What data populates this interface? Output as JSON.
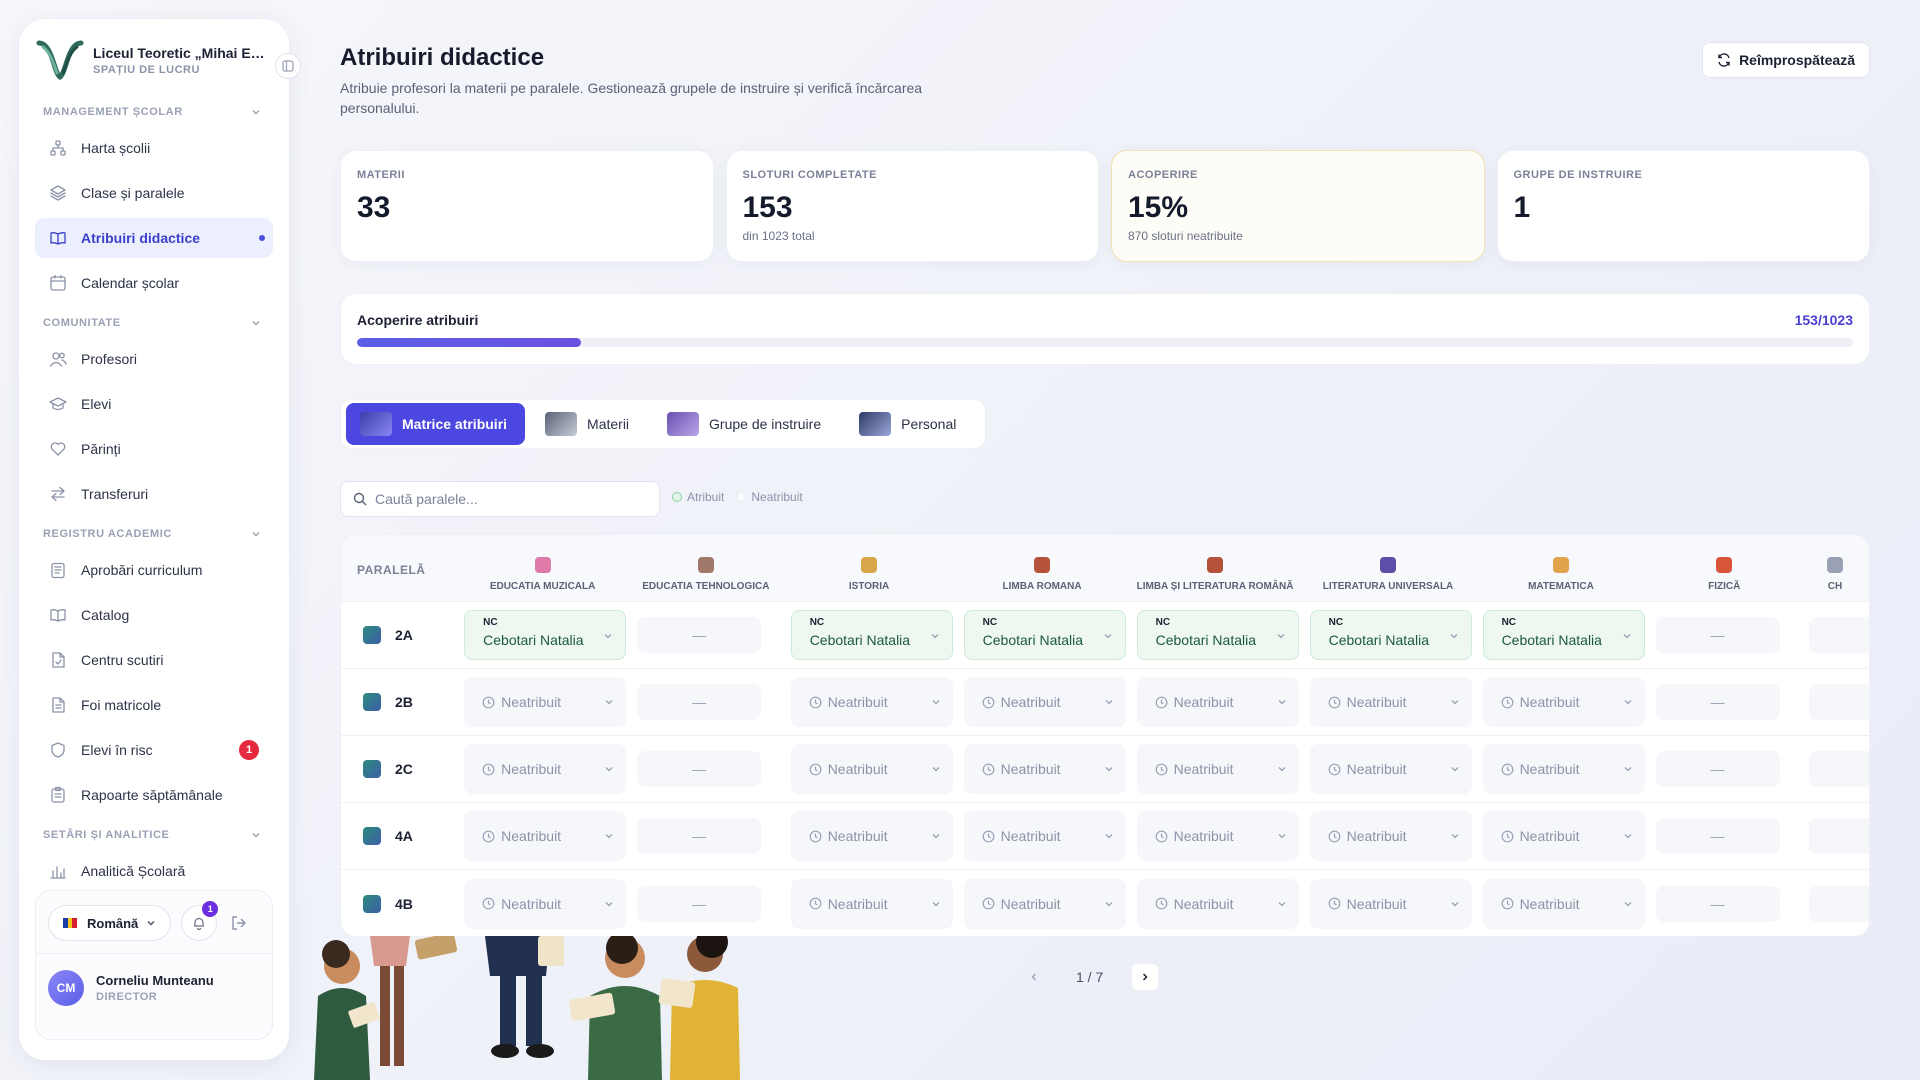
{
  "sidebar": {
    "brand_name": "Liceul Teoretic „Mihai Eminescu”",
    "brand_sub": "SPAȚIU DE LUCRU",
    "sections": [
      {
        "title": "MANAGEMENT ȘCOLAR",
        "items": [
          {
            "label": "Harta școlii",
            "icon": "sitemap-icon"
          },
          {
            "label": "Clase și paralele",
            "icon": "layers-icon"
          },
          {
            "label": "Atribuiri didactice",
            "icon": "book-open-icon",
            "active": true
          },
          {
            "label": "Calendar școlar",
            "icon": "calendar-icon"
          }
        ]
      },
      {
        "title": "COMUNITATE",
        "items": [
          {
            "label": "Profesori",
            "icon": "users-icon"
          },
          {
            "label": "Elevi",
            "icon": "graduation-cap-icon"
          },
          {
            "label": "Părinți",
            "icon": "heart-icon"
          },
          {
            "label": "Transferuri",
            "icon": "arrows-swap-icon"
          }
        ]
      },
      {
        "title": "REGISTRU ACADEMIC",
        "items": [
          {
            "label": "Aprobări curriculum",
            "icon": "clipboard-icon"
          },
          {
            "label": "Catalog",
            "icon": "book-icon"
          },
          {
            "label": "Centru scutiri",
            "icon": "file-icon"
          },
          {
            "label": "Foi matricole",
            "icon": "file-text-icon"
          },
          {
            "label": "Elevi în risc",
            "icon": "shield-icon",
            "badge": "1"
          },
          {
            "label": "Rapoarte săptămânale",
            "icon": "clipboard-list-icon"
          }
        ]
      },
      {
        "title": "SETĂRI ȘI ANALITICE",
        "items": [
          {
            "label": "Analitică Școlară",
            "icon": "bar-chart-icon"
          }
        ]
      }
    ],
    "footer": {
      "language": "Română",
      "notifications_badge": "1",
      "user_initials": "CM",
      "user_name": "Corneliu Munteanu",
      "user_role": "DIRECTOR"
    }
  },
  "header": {
    "title": "Atribuiri didactice",
    "description": "Atribuie profesori la materii pe paralele. Gestionează grupele de instruire și verifică încărcarea personalului.",
    "refresh_label": "Reîmprospătează"
  },
  "stats": [
    {
      "label": "MATERII",
      "value": "33",
      "sub": ""
    },
    {
      "label": "SLOTURI COMPLETATE",
      "value": "153",
      "sub": "din 1023 total"
    },
    {
      "label": "ACOPERIRE",
      "value": "15%",
      "sub": "870 sloturi neatribuite"
    },
    {
      "label": "GRUPE DE INSTRUIRE",
      "value": "1",
      "sub": ""
    }
  ],
  "coverage": {
    "label": "Acoperire atribuiri",
    "value_text": "153/1023",
    "fraction": 0.1496
  },
  "tabs": [
    {
      "label": "Matrice atribuiri",
      "active": true
    },
    {
      "label": "Materii"
    },
    {
      "label": "Grupe de instruire"
    },
    {
      "label": "Personal"
    }
  ],
  "search": {
    "placeholder": "Caută paralele..."
  },
  "legend": {
    "assigned": "Atribuit",
    "unassigned": "Neatribuit"
  },
  "table": {
    "first_header": "PARALELĂ",
    "columns": [
      {
        "label": "EDUCATIA MUZICALA",
        "icon": "music-icon"
      },
      {
        "label": "EDUCATIA TEHNOLOGICA",
        "icon": "gear-icon"
      },
      {
        "label": "ISTORIA",
        "icon": "scroll-icon"
      },
      {
        "label": "LIMBA ROMANA",
        "icon": "quill-icon"
      },
      {
        "label": "LIMBA ȘI LITERATURA ROMÂNĂ",
        "icon": "quill-icon"
      },
      {
        "label": "LITERATURA UNIVERSALA",
        "icon": "globe-book-icon"
      },
      {
        "label": "MATEMATICA",
        "icon": "ruler-icon"
      },
      {
        "label": "FIZICĂ",
        "icon": "atom-icon"
      },
      {
        "label": "CH",
        "icon": "flask-icon"
      }
    ],
    "unassigned_label": "Neatribuit",
    "empty_label": "—",
    "rows": [
      {
        "name": "2A",
        "cells": [
          {
            "type": "assigned",
            "code": "NC",
            "teacher": "Cebotari Natalia"
          },
          {
            "type": "empty"
          },
          {
            "type": "assigned",
            "code": "NC",
            "teacher": "Cebotari Natalia"
          },
          {
            "type": "assigned",
            "code": "NC",
            "teacher": "Cebotari Natalia"
          },
          {
            "type": "assigned",
            "code": "NC",
            "teacher": "Cebotari Natalia"
          },
          {
            "type": "assigned",
            "code": "NC",
            "teacher": "Cebotari Natalia"
          },
          {
            "type": "assigned",
            "code": "NC",
            "teacher": "Cebotari Natalia"
          },
          {
            "type": "empty"
          },
          {
            "type": "edge"
          }
        ]
      },
      {
        "name": "2B",
        "cells": [
          {
            "type": "unassigned"
          },
          {
            "type": "empty"
          },
          {
            "type": "unassigned"
          },
          {
            "type": "unassigned"
          },
          {
            "type": "unassigned"
          },
          {
            "type": "unassigned"
          },
          {
            "type": "unassigned"
          },
          {
            "type": "empty"
          },
          {
            "type": "edge"
          }
        ]
      },
      {
        "name": "2C",
        "cells": [
          {
            "type": "unassigned"
          },
          {
            "type": "empty"
          },
          {
            "type": "unassigned"
          },
          {
            "type": "unassigned"
          },
          {
            "type": "unassigned"
          },
          {
            "type": "unassigned"
          },
          {
            "type": "unassigned"
          },
          {
            "type": "empty"
          },
          {
            "type": "edge"
          }
        ]
      },
      {
        "name": "4A",
        "cells": [
          {
            "type": "unassigned"
          },
          {
            "type": "empty"
          },
          {
            "type": "unassigned"
          },
          {
            "type": "unassigned"
          },
          {
            "type": "unassigned"
          },
          {
            "type": "unassigned"
          },
          {
            "type": "unassigned"
          },
          {
            "type": "empty"
          },
          {
            "type": "edge"
          }
        ]
      },
      {
        "name": "4B",
        "cells": [
          {
            "type": "unassigned"
          },
          {
            "type": "empty"
          },
          {
            "type": "unassigned"
          },
          {
            "type": "unassigned"
          },
          {
            "type": "unassigned"
          },
          {
            "type": "unassigned"
          },
          {
            "type": "unassigned"
          },
          {
            "type": "empty"
          },
          {
            "type": "edge"
          }
        ]
      }
    ]
  },
  "pagination": {
    "info": "1 / 7"
  },
  "colors": {
    "accent": "#4b47e0",
    "assigned_bg": "#eef8f1",
    "badge_red": "#e5293f"
  }
}
